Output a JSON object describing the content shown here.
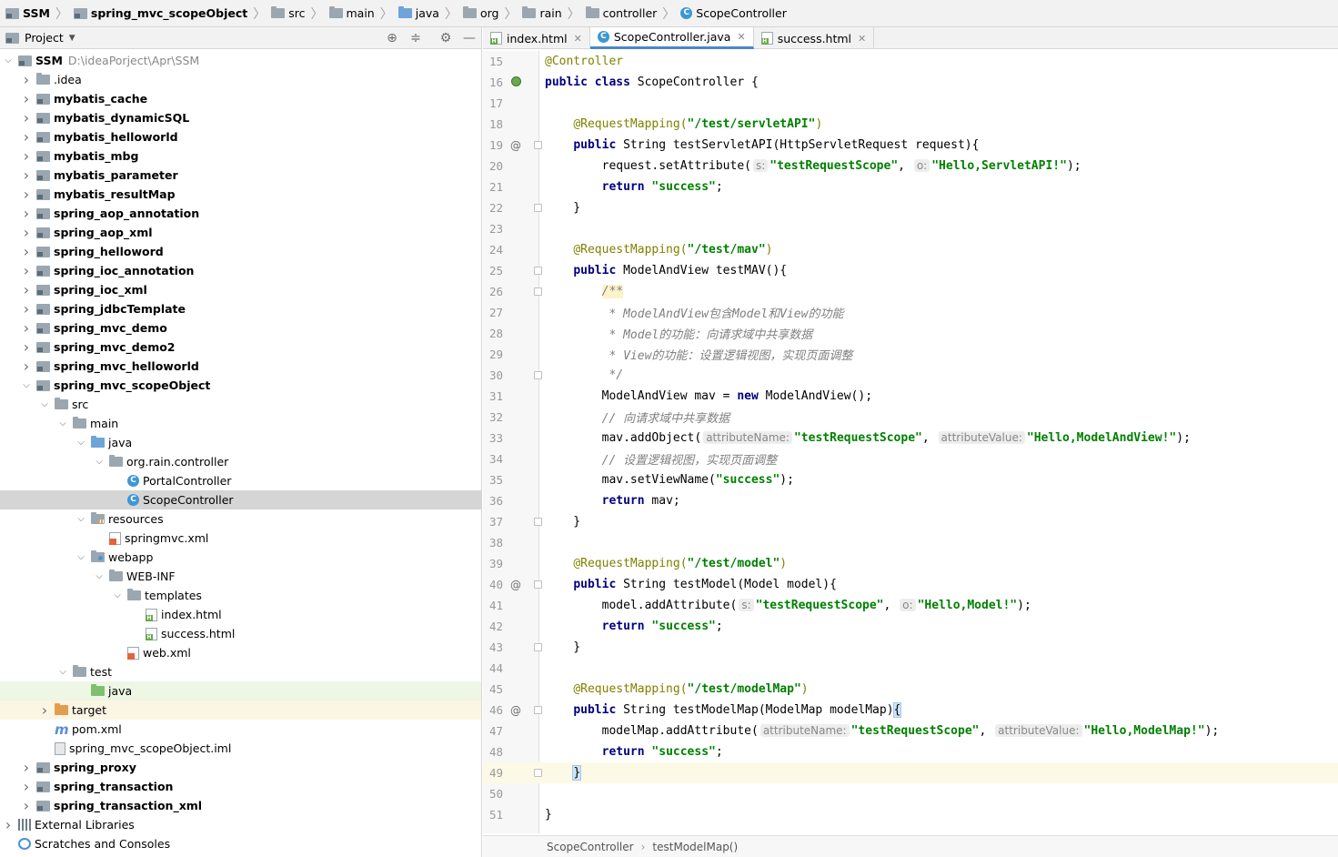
{
  "breadcrumb": [
    "SSM",
    "spring_mvc_scopeObject",
    "src",
    "main",
    "java",
    "org",
    "rain",
    "controller",
    "ScopeController"
  ],
  "project_panel": {
    "title": "Project",
    "tools": {
      "locate": "locate-icon",
      "collapse": "collapse-icon",
      "settings": "gear-icon",
      "hide": "minimize-icon"
    },
    "tree": [
      {
        "label": "SSM",
        "path": "D:\\ideaPorject\\Apr\\SSM",
        "icon": "module",
        "depth": 0,
        "expanded": true,
        "bold": true
      },
      {
        "label": ".idea",
        "icon": "folder",
        "depth": 1,
        "expanded": false
      },
      {
        "label": "mybatis_cache",
        "icon": "module",
        "depth": 1,
        "expanded": false,
        "bold": true
      },
      {
        "label": "mybatis_dynamicSQL",
        "icon": "module",
        "depth": 1,
        "expanded": false,
        "bold": true
      },
      {
        "label": "mybatis_helloworld",
        "icon": "module",
        "depth": 1,
        "expanded": false,
        "bold": true
      },
      {
        "label": "mybatis_mbg",
        "icon": "module",
        "depth": 1,
        "expanded": false,
        "bold": true
      },
      {
        "label": "mybatis_parameter",
        "icon": "module",
        "depth": 1,
        "expanded": false,
        "bold": true
      },
      {
        "label": "mybatis_resultMap",
        "icon": "module",
        "depth": 1,
        "expanded": false,
        "bold": true
      },
      {
        "label": "spring_aop_annotation",
        "icon": "module",
        "depth": 1,
        "expanded": false,
        "bold": true
      },
      {
        "label": "spring_aop_xml",
        "icon": "module",
        "depth": 1,
        "expanded": false,
        "bold": true
      },
      {
        "label": "spring_helloword",
        "icon": "module",
        "depth": 1,
        "expanded": false,
        "bold": true
      },
      {
        "label": "spring_ioc_annotation",
        "icon": "module",
        "depth": 1,
        "expanded": false,
        "bold": true
      },
      {
        "label": "spring_ioc_xml",
        "icon": "module",
        "depth": 1,
        "expanded": false,
        "bold": true
      },
      {
        "label": "spring_jdbcTemplate",
        "icon": "module",
        "depth": 1,
        "expanded": false,
        "bold": true
      },
      {
        "label": "spring_mvc_demo",
        "icon": "module",
        "depth": 1,
        "expanded": false,
        "bold": true
      },
      {
        "label": "spring_mvc_demo2",
        "icon": "module",
        "depth": 1,
        "expanded": false,
        "bold": true
      },
      {
        "label": "spring_mvc_helloworld",
        "icon": "module",
        "depth": 1,
        "expanded": false,
        "bold": true
      },
      {
        "label": "spring_mvc_scopeObject",
        "icon": "module",
        "depth": 1,
        "expanded": true,
        "bold": true
      },
      {
        "label": "src",
        "icon": "folder",
        "depth": 2,
        "expanded": true
      },
      {
        "label": "main",
        "icon": "folder",
        "depth": 3,
        "expanded": true
      },
      {
        "label": "java",
        "icon": "folder-src",
        "depth": 4,
        "expanded": true
      },
      {
        "label": "org.rain.controller",
        "icon": "folder",
        "depth": 5,
        "expanded": true
      },
      {
        "label": "PortalController",
        "icon": "class",
        "depth": 6
      },
      {
        "label": "ScopeController",
        "icon": "class",
        "depth": 6,
        "selected": true
      },
      {
        "label": "resources",
        "icon": "folder-res",
        "depth": 4,
        "expanded": true
      },
      {
        "label": "springmvc.xml",
        "icon": "xml",
        "depth": 5
      },
      {
        "label": "webapp",
        "icon": "folder-web",
        "depth": 4,
        "expanded": true
      },
      {
        "label": "WEB-INF",
        "icon": "folder",
        "depth": 5,
        "expanded": true
      },
      {
        "label": "templates",
        "icon": "folder",
        "depth": 6,
        "expanded": true
      },
      {
        "label": "index.html",
        "icon": "html",
        "depth": 7
      },
      {
        "label": "success.html",
        "icon": "html",
        "depth": 7
      },
      {
        "label": "web.xml",
        "icon": "xml",
        "depth": 6
      },
      {
        "label": "test",
        "icon": "folder",
        "depth": 3,
        "expanded": true
      },
      {
        "label": "java",
        "icon": "folder-test",
        "depth": 4,
        "highlight": "test"
      },
      {
        "label": "target",
        "icon": "folder-excl",
        "depth": 2,
        "expanded": false,
        "highlight": "target"
      },
      {
        "label": "pom.xml",
        "icon": "maven",
        "depth": 2
      },
      {
        "label": "spring_mvc_scopeObject.iml",
        "icon": "iml",
        "depth": 2
      },
      {
        "label": "spring_proxy",
        "icon": "module",
        "depth": 1,
        "expanded": false,
        "bold": true
      },
      {
        "label": "spring_transaction",
        "icon": "module",
        "depth": 1,
        "expanded": false,
        "bold": true
      },
      {
        "label": "spring_transaction_xml",
        "icon": "module",
        "depth": 1,
        "expanded": false,
        "bold": true
      },
      {
        "label": "External Libraries",
        "icon": "libs",
        "depth": 0,
        "expanded": false
      },
      {
        "label": "Scratches and Consoles",
        "icon": "console",
        "depth": 0
      }
    ]
  },
  "editor": {
    "tabs": [
      {
        "label": "index.html",
        "icon": "html",
        "active": false
      },
      {
        "label": "ScopeController.java",
        "icon": "class",
        "active": true
      },
      {
        "label": "success.html",
        "icon": "html",
        "active": false
      }
    ],
    "current_line": 49,
    "lines": [
      {
        "n": 15,
        "tokens": [
          [
            "an",
            "@Controller"
          ]
        ]
      },
      {
        "n": 16,
        "mark": "bean",
        "tokens": [
          [
            "kw",
            "public class "
          ],
          [
            "",
            "ScopeController {"
          ]
        ]
      },
      {
        "n": 17,
        "tokens": []
      },
      {
        "n": 18,
        "tokens": [
          [
            "",
            "    "
          ],
          [
            "an",
            "@RequestMapping("
          ],
          [
            "str",
            "\"/test/servletAPI\""
          ],
          [
            "an",
            ")"
          ]
        ]
      },
      {
        "n": 19,
        "mark": "@",
        "fold": true,
        "tokens": [
          [
            "",
            "    "
          ],
          [
            "kw",
            "public "
          ],
          [
            "",
            "String testServletAPI(HttpServletRequest request){"
          ]
        ]
      },
      {
        "n": 20,
        "tokens": [
          [
            "",
            "        request.setAttribute("
          ],
          [
            "hint",
            "s:"
          ],
          [
            "str",
            "\"testRequestScope\""
          ],
          [
            "",
            ", "
          ],
          [
            "hint",
            "o:"
          ],
          [
            "str",
            "\"Hello,ServletAPI!\""
          ],
          [
            "",
            ");"
          ]
        ]
      },
      {
        "n": 21,
        "tokens": [
          [
            "",
            "        "
          ],
          [
            "kw",
            "return "
          ],
          [
            "str",
            "\"success\""
          ],
          [
            "",
            ";"
          ]
        ]
      },
      {
        "n": 22,
        "fold": true,
        "tokens": [
          [
            "",
            "    }"
          ]
        ]
      },
      {
        "n": 23,
        "tokens": []
      },
      {
        "n": 24,
        "tokens": [
          [
            "",
            "    "
          ],
          [
            "an",
            "@RequestMapping("
          ],
          [
            "str",
            "\"/test/mav\""
          ],
          [
            "an",
            ")"
          ]
        ]
      },
      {
        "n": 25,
        "fold": true,
        "tokens": [
          [
            "",
            "    "
          ],
          [
            "kw",
            "public "
          ],
          [
            "",
            "ModelAndView testMAV(){"
          ]
        ]
      },
      {
        "n": 26,
        "fold": true,
        "tokens": [
          [
            "",
            "        "
          ],
          [
            "cm doc-hl",
            "/**"
          ]
        ]
      },
      {
        "n": 27,
        "tokens": [
          [
            "cm",
            "         * ModelAndView包含Model和View的功能"
          ]
        ]
      },
      {
        "n": 28,
        "tokens": [
          [
            "cm",
            "         * Model的功能：向请求域中共享数据"
          ]
        ]
      },
      {
        "n": 29,
        "tokens": [
          [
            "cm",
            "         * View的功能：设置逻辑视图，实现页面调整"
          ]
        ]
      },
      {
        "n": 30,
        "fold": true,
        "tokens": [
          [
            "cm",
            "         */"
          ]
        ]
      },
      {
        "n": 31,
        "tokens": [
          [
            "",
            "        ModelAndView mav = "
          ],
          [
            "kw",
            "new "
          ],
          [
            "",
            "ModelAndView();"
          ]
        ]
      },
      {
        "n": 32,
        "tokens": [
          [
            "cm",
            "        // 向请求域中共享数据"
          ]
        ]
      },
      {
        "n": 33,
        "tokens": [
          [
            "",
            "        mav.addObject("
          ],
          [
            "hint",
            "attributeName:"
          ],
          [
            "str",
            "\"testRequestScope\""
          ],
          [
            "",
            ", "
          ],
          [
            "hint",
            "attributeValue:"
          ],
          [
            "str",
            "\"Hello,ModelAndView!\""
          ],
          [
            "",
            ");"
          ]
        ]
      },
      {
        "n": 34,
        "tokens": [
          [
            "cm",
            "        // 设置逻辑视图，实现页面调整"
          ]
        ]
      },
      {
        "n": 35,
        "tokens": [
          [
            "",
            "        mav.setViewName("
          ],
          [
            "str",
            "\"success\""
          ],
          [
            "",
            ");"
          ]
        ]
      },
      {
        "n": 36,
        "tokens": [
          [
            "",
            "        "
          ],
          [
            "kw",
            "return "
          ],
          [
            "",
            "mav;"
          ]
        ]
      },
      {
        "n": 37,
        "fold": true,
        "tokens": [
          [
            "",
            "    }"
          ]
        ]
      },
      {
        "n": 38,
        "tokens": []
      },
      {
        "n": 39,
        "tokens": [
          [
            "",
            "    "
          ],
          [
            "an",
            "@RequestMapping("
          ],
          [
            "str",
            "\"/test/model\""
          ],
          [
            "an",
            ")"
          ]
        ]
      },
      {
        "n": 40,
        "mark": "@",
        "fold": true,
        "tokens": [
          [
            "",
            "    "
          ],
          [
            "kw",
            "public "
          ],
          [
            "",
            "String testModel(Model model){"
          ]
        ]
      },
      {
        "n": 41,
        "tokens": [
          [
            "",
            "        model.addAttribute("
          ],
          [
            "hint",
            "s:"
          ],
          [
            "str",
            "\"testRequestScope\""
          ],
          [
            "",
            ", "
          ],
          [
            "hint",
            "o:"
          ],
          [
            "str",
            "\"Hello,Model!\""
          ],
          [
            "",
            ");"
          ]
        ]
      },
      {
        "n": 42,
        "tokens": [
          [
            "",
            "        "
          ],
          [
            "kw",
            "return "
          ],
          [
            "str",
            "\"success\""
          ],
          [
            "",
            ";"
          ]
        ]
      },
      {
        "n": 43,
        "fold": true,
        "tokens": [
          [
            "",
            "    }"
          ]
        ]
      },
      {
        "n": 44,
        "tokens": []
      },
      {
        "n": 45,
        "tokens": [
          [
            "",
            "    "
          ],
          [
            "an",
            "@RequestMapping("
          ],
          [
            "str",
            "\"/test/modelMap\""
          ],
          [
            "an",
            ")"
          ]
        ]
      },
      {
        "n": 46,
        "mark": "@",
        "fold": true,
        "tokens": [
          [
            "",
            "    "
          ],
          [
            "kw",
            "public "
          ],
          [
            "",
            "String testModelMap(ModelMap modelMap)"
          ],
          [
            "brace-hl",
            "{"
          ]
        ]
      },
      {
        "n": 47,
        "tokens": [
          [
            "",
            "        modelMap.addAttribute("
          ],
          [
            "hint",
            "attributeName:"
          ],
          [
            "str",
            "\"testRequestScope\""
          ],
          [
            "",
            ", "
          ],
          [
            "hint",
            "attributeValue:"
          ],
          [
            "str",
            "\"Hello,ModelMap!\""
          ],
          [
            "",
            ");"
          ]
        ]
      },
      {
        "n": 48,
        "tokens": [
          [
            "",
            "        "
          ],
          [
            "kw",
            "return "
          ],
          [
            "str",
            "\"success\""
          ],
          [
            "",
            ";"
          ]
        ]
      },
      {
        "n": 49,
        "fold": true,
        "tokens": [
          [
            "",
            "    "
          ],
          [
            "brace-hl",
            "}"
          ]
        ]
      },
      {
        "n": 50,
        "tokens": []
      },
      {
        "n": 51,
        "tokens": [
          [
            "",
            "}"
          ]
        ]
      }
    ],
    "status_crumbs": [
      "ScopeController",
      "testModelMap()"
    ]
  }
}
